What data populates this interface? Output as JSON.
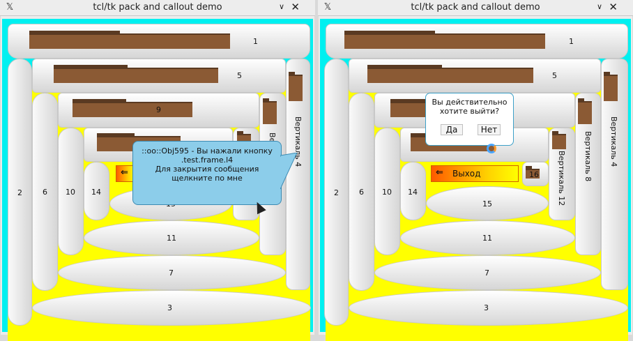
{
  "window_title": "tcl/tk pack and callout demo",
  "titlebar_icons": {
    "logo": "x11-logo-icon",
    "minimize": "chevron-down-icon",
    "close": "close-icon"
  },
  "glyphs": {
    "logo": "𝕏",
    "minimize": "∨",
    "close": "✕",
    "exit": "⇐"
  },
  "colors": {
    "border": "#00f0f0",
    "fill": "#ffff00",
    "folder": "#8b5a34",
    "callout": "#8ccdea"
  },
  "labels": {
    "p1": "1",
    "p2": "2",
    "p3": "3",
    "p5": "5",
    "p6": "6",
    "p7": "7",
    "p9": "9",
    "p10": "10",
    "p11": "11",
    "p14": "14",
    "p15": "15",
    "p16": "16",
    "v4": "Вертикаль 4",
    "v8": "Вертикаль 8",
    "v8_cut": "Вер",
    "v12": "Вертикаль 12"
  },
  "exit_button": {
    "label": "Выход"
  },
  "callout": {
    "line1": "::oo::Obj595 - Вы нажали кнопку",
    "line2": ".test.frame.l4",
    "line3": "Для закрытия сообщения",
    "line4": "щелкните по мне"
  },
  "dialog": {
    "line1": "Вы действительно",
    "line2": "хотите выйти?",
    "yes": "Да",
    "no": "Нет"
  }
}
